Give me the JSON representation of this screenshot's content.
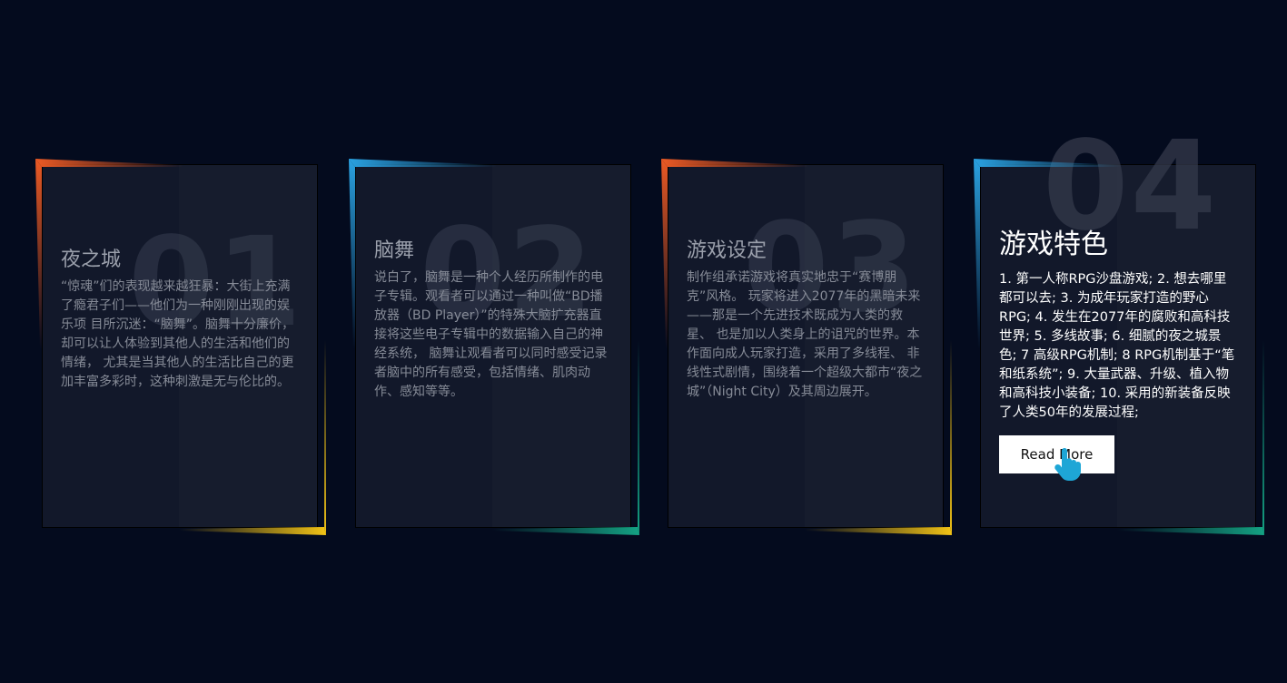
{
  "cards": [
    {
      "number": "01",
      "title": "夜之城",
      "description": "“惊魂”们的表现越来越狂暴：大街上充满了瘾君子们——他们为一种刚刚出现的娱乐项 目所沉迷：“脑舞”。脑舞十分廉价，却可以让人体验到其他人的生活和他们的情绪， 尤其是当其他人的生活比自己的更加丰富多彩时，这种刺激是无与伦比的。"
    },
    {
      "number": "02",
      "title": "脑舞",
      "description": "说白了，脑舞是一种个人经历所制作的电子专辑。观看者可以通过一种叫做“BD播放器（BD Player）”的特殊大脑扩充器直接将这些电子专辑中的数据输入自己的神经系统， 脑舞让观看者可以同时感受记录者脑中的所有感受，包括情绪、肌肉动作、感知等等。"
    },
    {
      "number": "03",
      "title": "游戏设定",
      "description": "制作组承诺游戏将真实地忠于“赛博朋克”风格。 玩家将进入2077年的黑暗未来——那是一个先进技术既成为人类的救星、 也是加以人类身上的诅咒的世界。本作面向成人玩家打造，采用了多线程、 非线性式剧情，围绕着一个超级大都市“夜之城”（Night City）及其周边展开。"
    },
    {
      "number": "04",
      "title": "游戏特色",
      "description": "1. 第一人称RPG沙盘游戏; 2. 想去哪里都可以去; 3. 为成年玩家打造的野心RPG; 4. 发生在2077年的腐败和高科技世界; 5. 多线故事; 6. 细腻的夜之城景色; 7 高级RPG机制; 8 RPG机制基于“笔和纸系统”; 9. 大量武器、升级、植入物和高科技小装备; 10. 采用的新装备反映了人类50年的发展过程;",
      "button_label": "Read More"
    }
  ],
  "colors": {
    "background": "#040b1e",
    "orange": "#ec5a24",
    "yellow": "#f2c316",
    "blue": "#2aa2e2",
    "teal": "#14a283",
    "cursor": "#1ea6d6"
  },
  "icons": {
    "cursor": "hand-pointer-icon"
  }
}
